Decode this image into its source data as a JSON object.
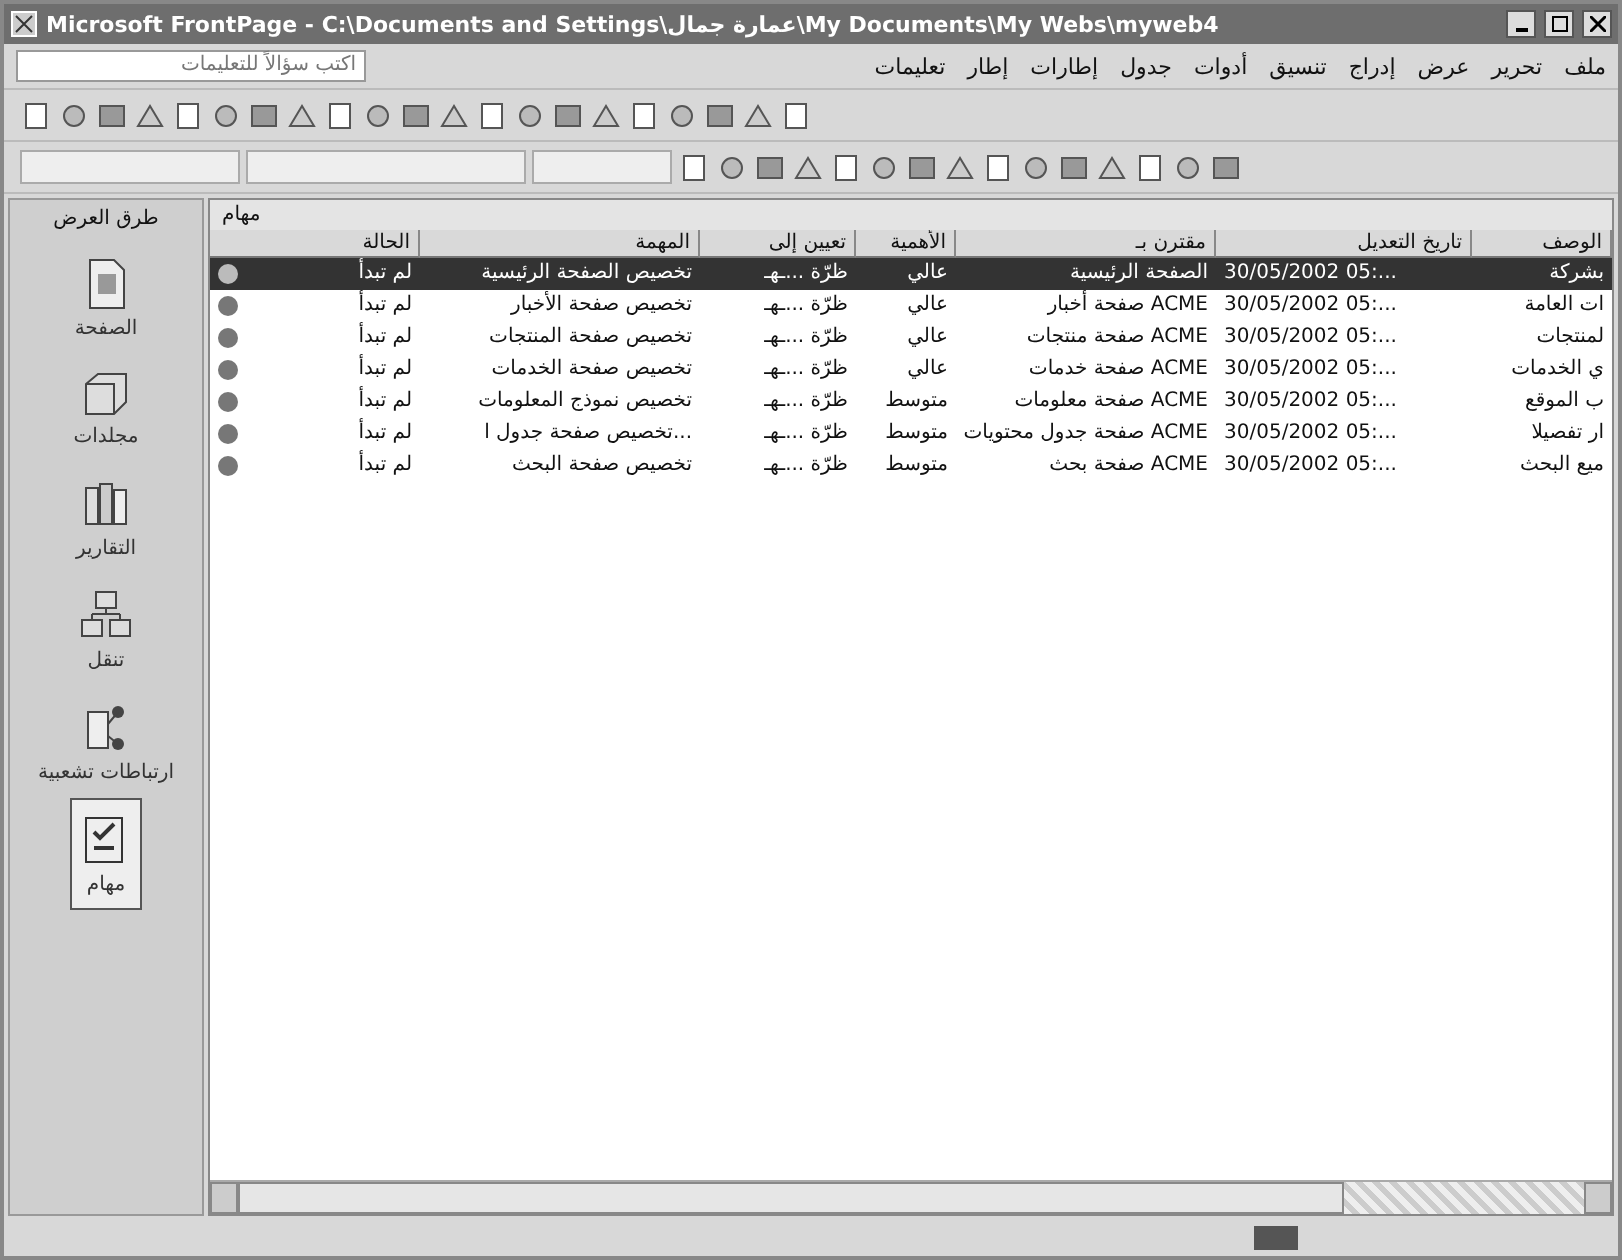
{
  "window": {
    "title": "Microsoft FrontPage - C:\\Documents and Settings\\عمارة جمال\\My Documents\\My Webs\\myweb4"
  },
  "menu": [
    "ملف",
    "تحرير",
    "عرض",
    "إدراج",
    "تنسيق",
    "أدوات",
    "جدول",
    "إطارات",
    "إطار",
    "تعليمات"
  ],
  "help_box": {
    "placeholder": "اكتب سؤالاً للتعليمات"
  },
  "views_bar": {
    "title": "طرق العرض",
    "items": [
      {
        "label": "الصفحة",
        "selected": false
      },
      {
        "label": "مجلدات",
        "selected": false
      },
      {
        "label": "التقارير",
        "selected": false
      },
      {
        "label": "تنقل",
        "selected": false
      },
      {
        "label": "ارتباطات تشعبية",
        "selected": false
      },
      {
        "label": "مهام",
        "selected": true
      }
    ]
  },
  "tasks": {
    "title": "مهام",
    "columns": [
      "الوصف",
      "تاريخ التعديل",
      "مقترن بـ",
      "الأهمية",
      "تعيين إلى",
      "المهمة",
      "الحالة"
    ],
    "rows": [
      {
        "selected": true,
        "cells": [
          "بشركة",
          "30/05/2002 05:...",
          "الصفحة الرئيسية",
          "عالي",
          "ظرّة ...ـهـ",
          "تخصيص الصفحة الرئيسية",
          "لم تبدأ"
        ]
      },
      {
        "selected": false,
        "cells": [
          "ات العامة",
          "30/05/2002 05:...",
          "ACME صفحة أخبار",
          "عالي",
          "ظرّة ...ـهـ",
          "تخصيص صفحة الأخبار",
          "لم تبدأ"
        ]
      },
      {
        "selected": false,
        "cells": [
          "لمنتجات",
          "30/05/2002 05:...",
          "ACME صفحة منتجات",
          "عالي",
          "ظرّة ...ـهـ",
          "تخصيص صفحة المنتجات",
          "لم تبدأ"
        ]
      },
      {
        "selected": false,
        "cells": [
          "ي الخدمات",
          "30/05/2002 05:...",
          "ACME صفحة خدمات",
          "عالي",
          "ظرّة ...ـهـ",
          "تخصيص صفحة الخدمات",
          "لم تبدأ"
        ]
      },
      {
        "selected": false,
        "cells": [
          "ب الموقع",
          "30/05/2002 05:...",
          "ACME صفحة معلومات",
          "متوسط",
          "ظرّة ...ـهـ",
          "تخصيص نموذج المعلومات",
          "لم تبدأ"
        ]
      },
      {
        "selected": false,
        "cells": [
          "ار تفصيلا",
          "30/05/2002 05:...",
          "ACME صفحة جدول محتويات",
          "متوسط",
          "ظرّة ...ـهـ",
          "...تخصيص صفحة جدول ا",
          "لم تبدأ"
        ]
      },
      {
        "selected": false,
        "cells": [
          "ميع البحث",
          "30/05/2002 05:...",
          "ACME صفحة بحث",
          "متوسط",
          "ظرّة ...ـهـ",
          "تخصيص صفحة البحث",
          "لم تبدأ"
        ]
      }
    ]
  }
}
